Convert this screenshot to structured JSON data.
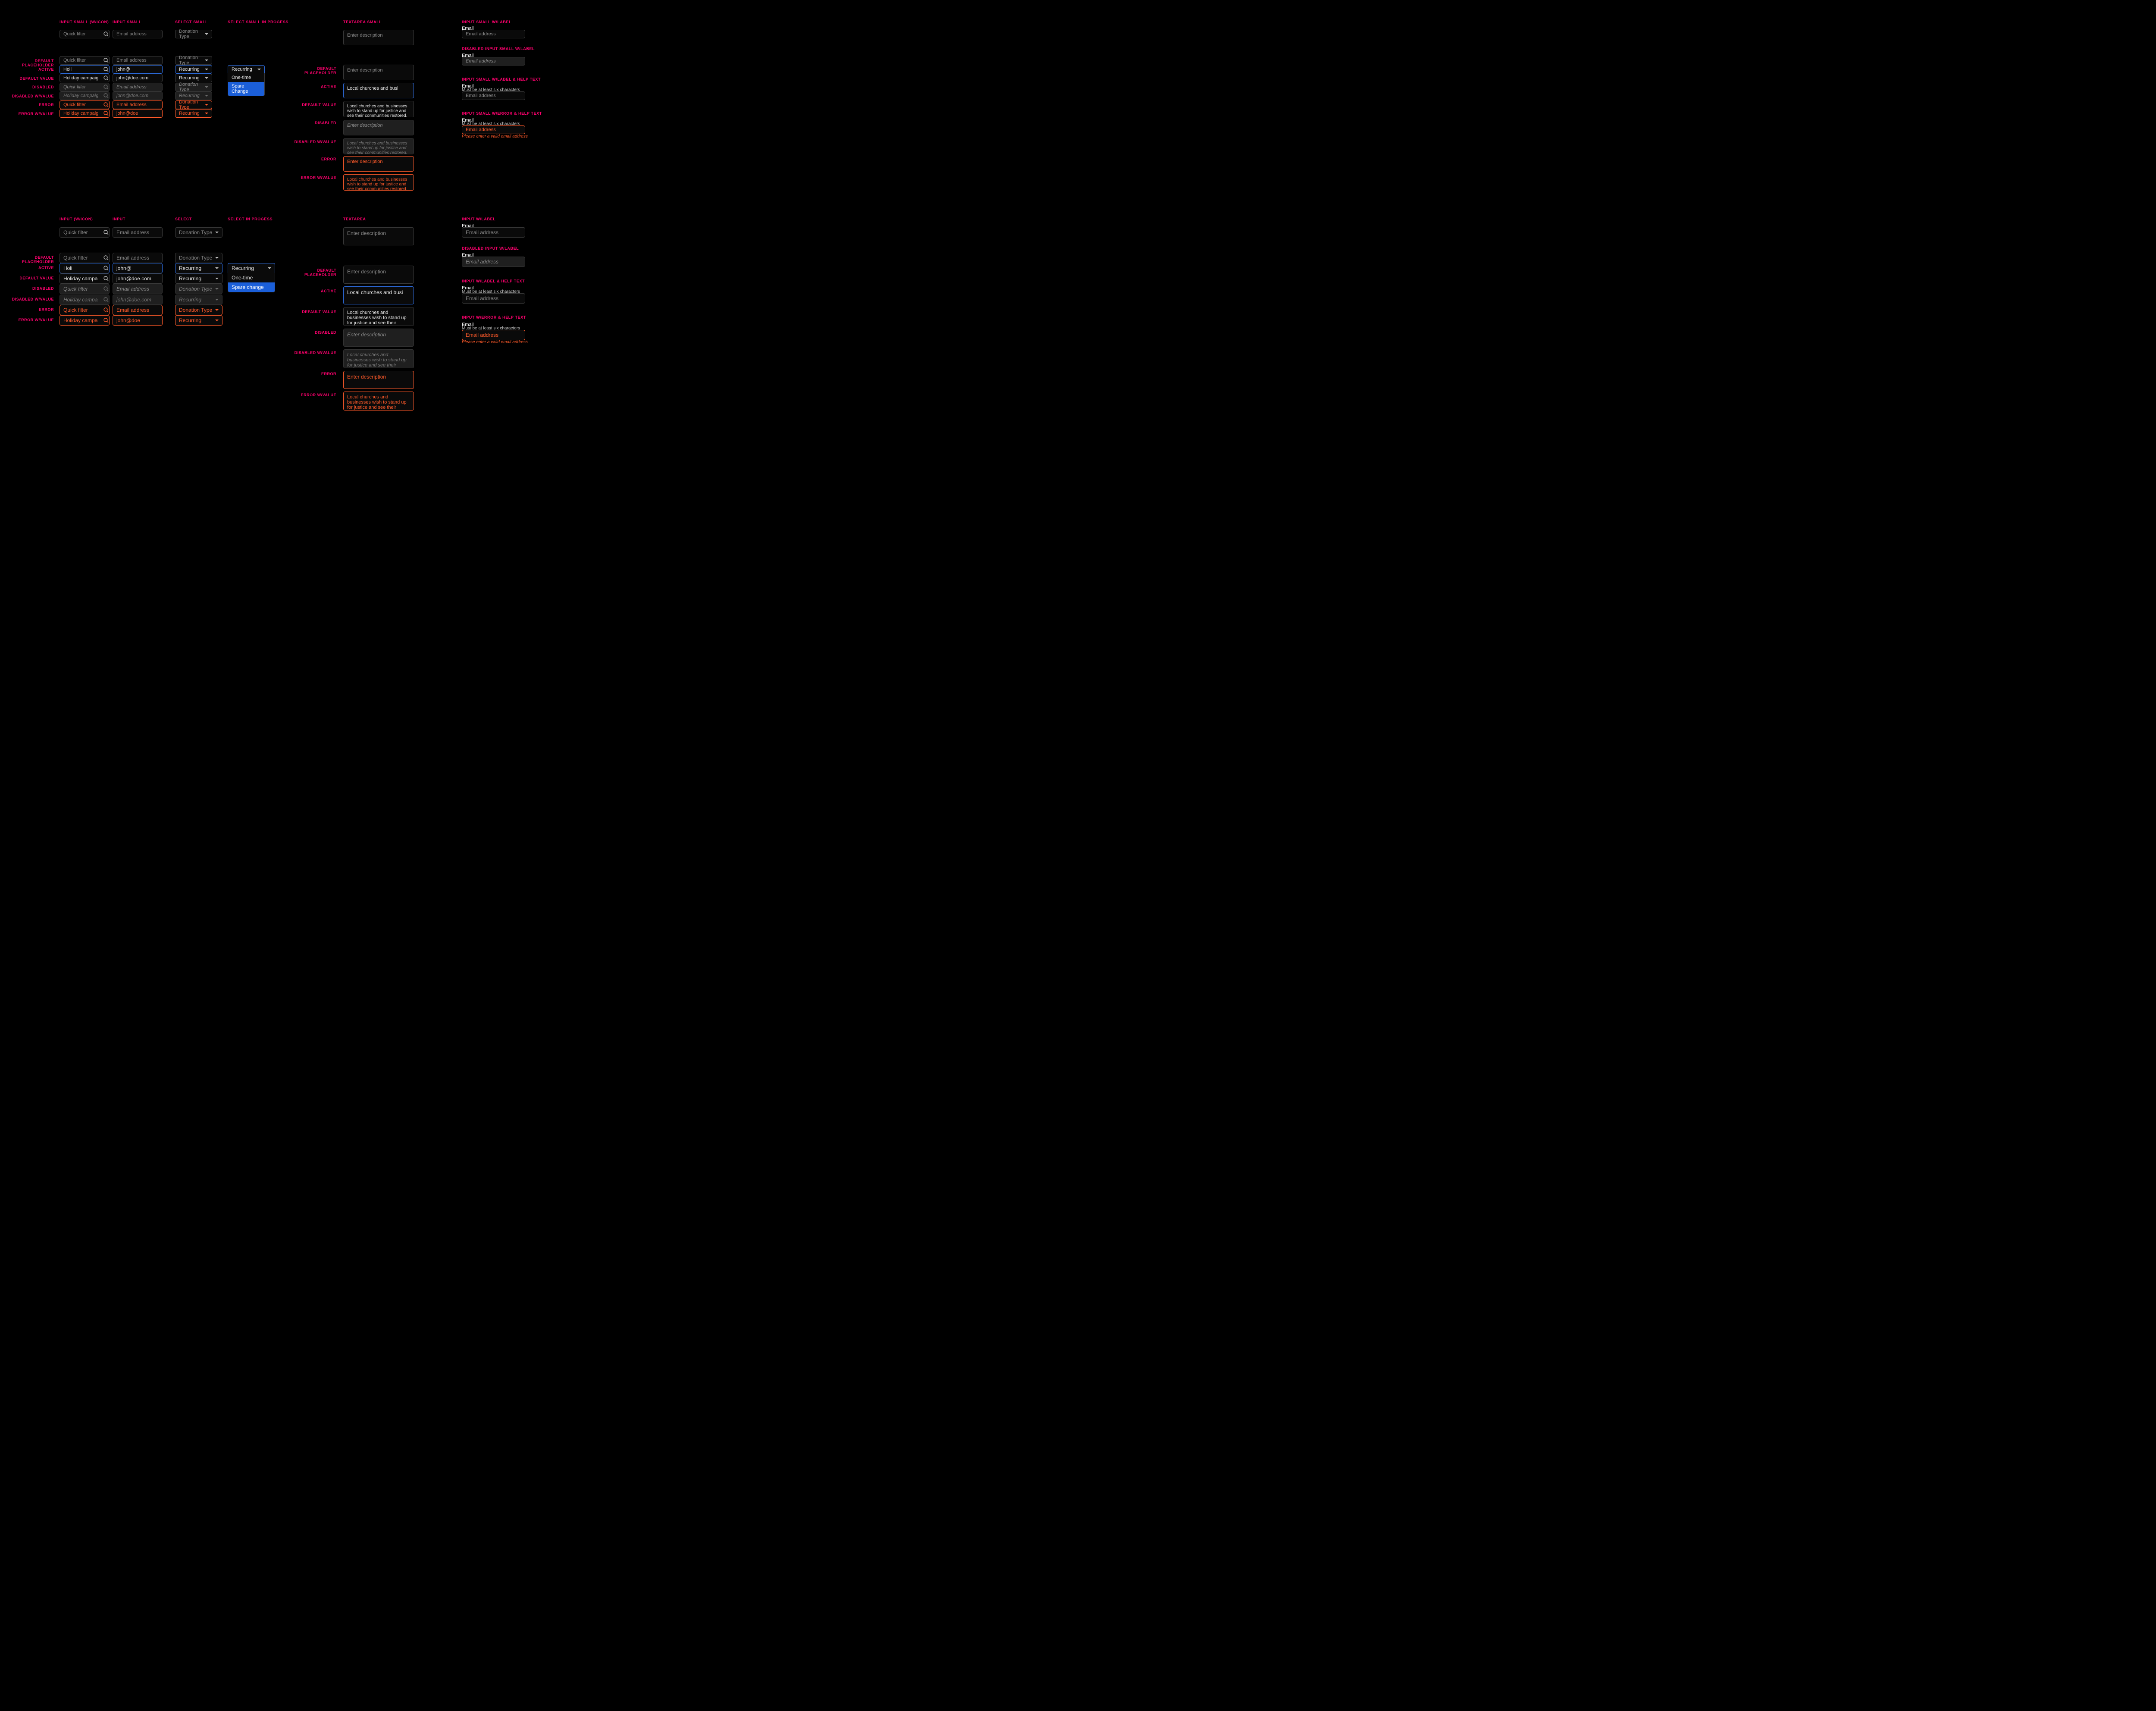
{
  "sections": {
    "top": {
      "input_icon": "INPUT SMALL (W/ICON)",
      "input": "INPUT SMALL",
      "select": "SELECT SMALL",
      "select_prog": "SELECT SMALL IN PROGESS",
      "textarea": "TEXTAREA SMALL",
      "col6a": "INPUT SMALL W/LABEL",
      "col6b": "DISABLED INPUT SMALL W/LABEL",
      "col6c": "INPUT SMALL W/LABEL & HELP TEXT",
      "col6d": "INPUT SMALL W/ERROR & HELP TEXT"
    },
    "bottom": {
      "input_icon": "INPUT (W/ICON)",
      "input": "INPUT",
      "select": "SELECT",
      "select_prog": "SELECT IN PROGESS",
      "textarea": "TEXTAREA",
      "col6a": "INPUT W/LABEL",
      "col6b": "DISABLED INPUT W/LABEL",
      "col6c": "INPUT W/LABEL & HELP TEXT",
      "col6d": "INPUT W/ERROR & HELP TEXT"
    }
  },
  "row_labels": [
    "DEFAULT PLACEHOLDER",
    "ACTIVE",
    "DEFAULT VALUE",
    "DISABLED",
    "DISABLED W/VALUE",
    "ERROR",
    "ERROR W/VALUE"
  ],
  "ta_row_labels": [
    "DEFAULT PLACEHOLDER",
    "ACTIVE",
    "DEFAULT VALUE",
    "DISABLED",
    "DISABLED W/VALUE",
    "ERROR",
    "ERROR W/VALUE"
  ],
  "ph": {
    "filter": "Quick filter",
    "email": "Email address",
    "donation": "Donation Type",
    "desc": "Enter description"
  },
  "vals": {
    "holi": "Holi",
    "holiday": "Holiday campaign",
    "johnat": "john@",
    "johndoe": "john@doe.com",
    "johnatdoe": "john@doe",
    "recurring": "Recurring",
    "ta_active": "Local churches and busi",
    "ta_value": "Local churches and businesses wish to stand up for justice and see their communities restored. We're here to help.",
    "ta_value_short": "Local churches and businesses wish to stand up for justice and see their communities restored."
  },
  "options": {
    "sm": [
      "Recurring",
      "One-time",
      "Spare Change"
    ],
    "md": [
      "Recurring",
      "One-time",
      "Spare change"
    ]
  },
  "label_email": "Email",
  "help_text": "Must be at least six characters",
  "error_text": "Please enter a valid email address"
}
